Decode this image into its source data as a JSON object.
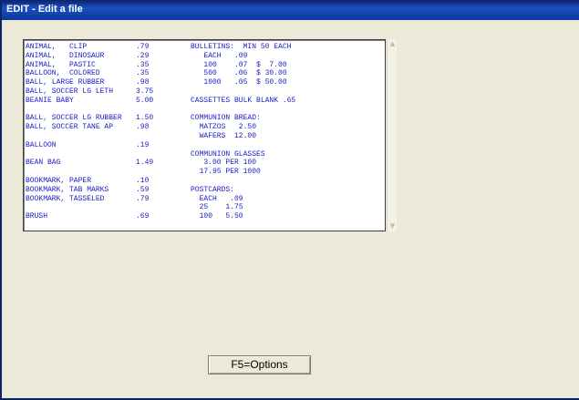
{
  "window": {
    "title": "EDIT - Edit a file"
  },
  "editor": {
    "left_lines": [
      {
        "item": "ANIMAL,   CLIP",
        "price": ".79"
      },
      {
        "item": "ANIMAL,   DINOSAUR",
        "price": ".29"
      },
      {
        "item": "ANIMAL,   PASTIC",
        "price": ".35"
      },
      {
        "item": "BALLOON,  COLORED",
        "price": ".35"
      },
      {
        "item": "BALL, LARGE RUBBER",
        "price": ".98"
      },
      {
        "item": "BALL, SOCCER LG LETH",
        "price": "3.75"
      },
      {
        "item": "BEANIE BABY",
        "price": "5.00"
      },
      {
        "item": "",
        "price": ""
      },
      {
        "item": "BALL, SOCCER LG RUBBER",
        "price": "1.50"
      },
      {
        "item": "BALL, SOCCER TANE AP",
        "price": ".98"
      },
      {
        "item": "",
        "price": ""
      },
      {
        "item": "BALLOON",
        "price": ".19"
      },
      {
        "item": "",
        "price": ""
      },
      {
        "item": "BEAN BAG",
        "price": "1.49"
      },
      {
        "item": "",
        "price": ""
      },
      {
        "item": "BOOKMARK, PAPER",
        "price": ".10"
      },
      {
        "item": "BOOKMARK, TAB MARKS",
        "price": ".59"
      },
      {
        "item": "BOOKMARK, TASSELED",
        "price": ".79"
      },
      {
        "item": "",
        "price": ""
      },
      {
        "item": "BRUSH",
        "price": ".69"
      }
    ],
    "right_lines": [
      "BULLETINS:  MIN 50 EACH",
      "   EACH   .09",
      "   100    .07  $  7.00",
      "   500    .06  $ 30.00",
      "   1000   .05  $ 50.00",
      "",
      "CASSETTES BULK BLANK .65",
      "",
      "COMMUNION BREAD:",
      "  MATZOS   2.50",
      "  WAFERS  12.00",
      "",
      "COMMUNION GLASSES",
      "   3.00 PER 100",
      "  17.95 PER 1000",
      "",
      "POSTCARDS:",
      "  EACH   .09",
      "  25    1.75",
      "  100   5.50"
    ]
  },
  "buttons": {
    "options_label": "F5=Options"
  }
}
